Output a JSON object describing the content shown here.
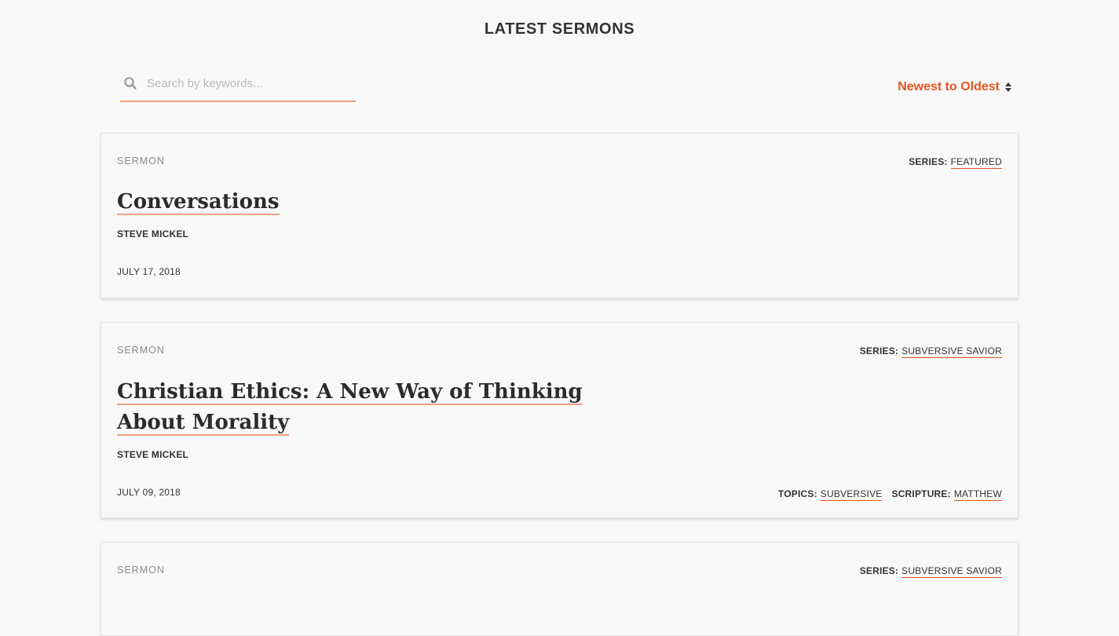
{
  "page": {
    "title": "LATEST SERMONS"
  },
  "search": {
    "placeholder": "Search by keywords...",
    "value": "",
    "icon": "search-icon"
  },
  "sort": {
    "label": "Newest to Oldest",
    "icon": "sort-arrows-icon"
  },
  "colors": {
    "accent": "#e8551f",
    "underline": "#f0a27a",
    "background": "#f8f8f8"
  },
  "sermons": [
    {
      "type": "SERMON",
      "series_label": "SERIES:",
      "series": "FEATURED",
      "title": "Conversations",
      "speaker": "STEVE MICKEL",
      "date": "JULY 17, 2018"
    },
    {
      "type": "SERMON",
      "series_label": "SERIES:",
      "series": "SUBVERSIVE SAVIOR",
      "title_line1": "Christian Ethics: A New Way of Thinking",
      "title_line2": "About Morality",
      "speaker": "STEVE MICKEL",
      "date": "JULY 09, 2018",
      "topics_label": "TOPICS:",
      "topics": "SUBVERSIVE",
      "scripture_label": "SCRIPTURE:",
      "scripture": "MATTHEW"
    },
    {
      "type": "SERMON",
      "series_label": "SERIES:",
      "series": "SUBVERSIVE SAVIOR"
    }
  ]
}
